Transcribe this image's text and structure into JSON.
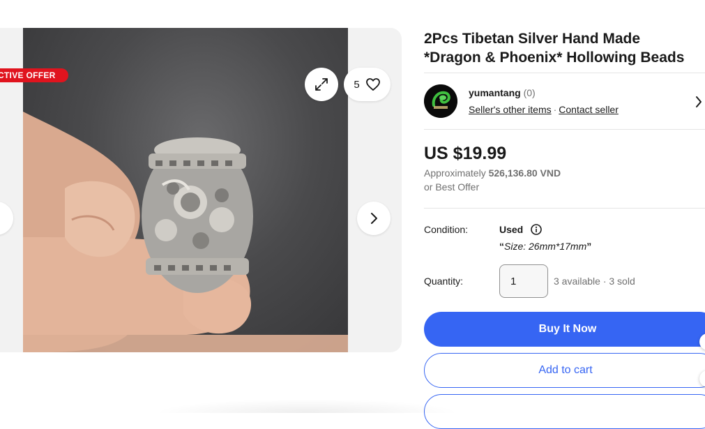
{
  "gallery": {
    "badge_text": "ACTIVE OFFER",
    "watch_count": "5",
    "icons": {
      "expand": "expand-icon",
      "watch": "heart-icon",
      "next": "chevron-right-icon",
      "prev": "chevron-left-icon"
    }
  },
  "listing": {
    "title_line1": "2Pcs Tibetan Silver Hand Made",
    "title_line2": "*Dragon & Phoenix* Hollowing Beads"
  },
  "seller": {
    "name": "yumantang",
    "feedback": "(0)",
    "other_items_link": "Seller's other items",
    "separator": "·",
    "contact_link": "Contact seller"
  },
  "pricing": {
    "price": "US $19.99",
    "approx_prefix": "Approximately",
    "approx_value": "526,136.80 VND",
    "best_offer": "or Best Offer"
  },
  "condition": {
    "label": "Condition:",
    "value": "Used",
    "note_open_quote": "“",
    "note": "Size: 26mm*17mm",
    "note_close_quote": "”"
  },
  "quantity": {
    "label": "Quantity:",
    "value": "1",
    "available": "3 available · 3 sold"
  },
  "actions": {
    "buy_now": "Buy It Now",
    "add_to_cart": "Add to cart"
  },
  "colors": {
    "primary_blue": "#3665f3",
    "badge_red": "#e0141e",
    "text_dark": "#191919",
    "text_muted": "#707070"
  }
}
